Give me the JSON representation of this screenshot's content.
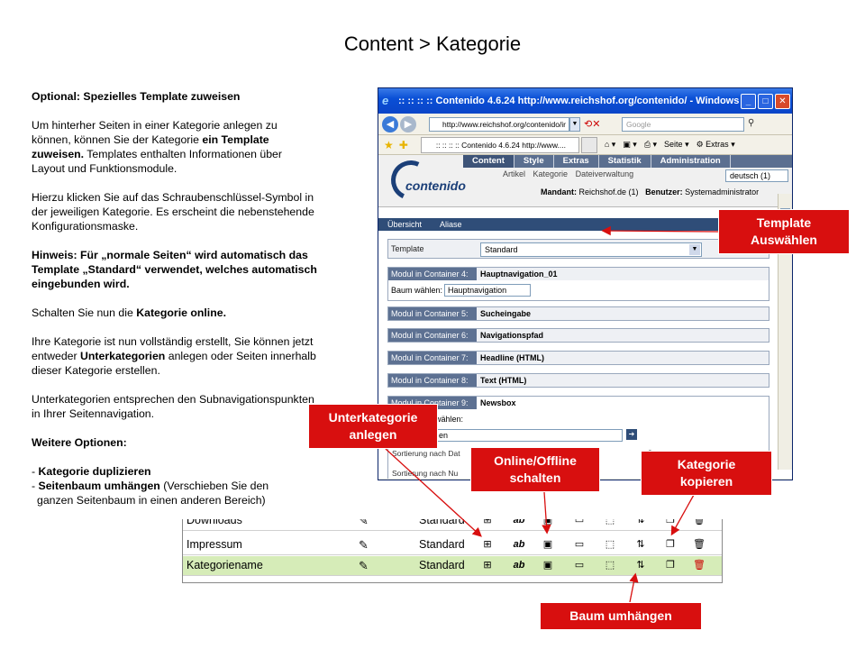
{
  "slide": {
    "title": "Content > Kategorie"
  },
  "instructions": {
    "heading": "Optional: Spezielles Template zuweisen",
    "p1_a": "Um hinterher Seiten in einer Kategorie anlegen zu können, können Sie der Kategorie ",
    "p1_b": "ein Template zuweisen.",
    "p1_c": " Templates enthalten Informationen über Layout und Funktionsmodule.",
    "p2": "Hierzu klicken Sie auf das Schraubenschlüssel-Symbol in der jeweiligen Kategorie. Es erscheint die nebenstehende Konfigurationsmaske.",
    "p3": "Hinweis: Für „normale Seiten“ wird automatisch das Template „Standard“ verwendet, welches automatisch eingebunden wird.",
    "p4_a": "Schalten Sie nun die ",
    "p4_b": "Kategorie online.",
    "p5_a": "Ihre Kategorie ist nun vollständig erstellt, Sie können jetzt entweder ",
    "p5_b": "Unterkategorien",
    "p5_c": " anlegen oder Seiten innerhalb dieser Kategorie erstellen.",
    "p6": "Unterkategorien entsprechen den Subnavigationspunkten in Ihrer Seitennavigation.",
    "p7": "Weitere Optionen:",
    "opt1_a": "- ",
    "opt1_b": "Kategorie duplizieren",
    "opt2_a": "- ",
    "opt2_b": "Seitenbaum umhängen",
    "opt2_c": " (Verschieben Sie den",
    "opt2_d": "ganzen Seitenbaum in einen anderen Bereich)"
  },
  "browser": {
    "title": ":: :: :: :: Contenido 4.6.24 http://www.reichshof.org/contenido/ - Windows Inter...",
    "address": "http://www.reichshof.org/contenido/ir",
    "search_placeholder": "Google",
    "tab_title": ":: :: :: :: Contenido 4.6.24 http://www....",
    "toolbar_page": "Seite",
    "toolbar_extras": "Extras"
  },
  "contenido": {
    "logo": "contenido",
    "mainnav": [
      "Content",
      "Style",
      "Extras",
      "Statistik",
      "Administration"
    ],
    "subnav": [
      "Artikel",
      "Kategorie",
      "Dateiverwaltung"
    ],
    "language": "deutsch (1)",
    "mandant_label": "Mandant:",
    "mandant_value": "Reichshof.de (1)",
    "user_label": "Benutzer:",
    "user_value": "Systemadministrator",
    "tabs": [
      "Übersicht",
      "Aliase"
    ],
    "template_label": "Template",
    "template_value": "Standard",
    "containers": [
      {
        "label": "Modul in Container 4:",
        "value": "Hauptnavigation_01"
      },
      {
        "label": "Modul in Container 5:",
        "value": "Sucheingabe"
      },
      {
        "label": "Modul in Container 6:",
        "value": "Navigationspfad"
      },
      {
        "label": "Modul in Container 7:",
        "value": "Headline (HTML)"
      },
      {
        "label": "Modul in Container 8:",
        "value": "Text (HTML)"
      },
      {
        "label": "Modul in Container 9:",
        "value": "Newsbox"
      }
    ],
    "baum_label": "Baum wählen:",
    "baum_value": "Hauptnavigation",
    "newsbox_label_fragment": "wählen:",
    "newsbox_select_fragment": "en",
    "sort1": "Sortierung nach Dat",
    "sort2": "Sortierung nach Nu"
  },
  "category_table": {
    "rows": [
      {
        "name": "Downloads",
        "template": "Standard"
      },
      {
        "name": "Impressum",
        "template": "Standard"
      },
      {
        "name": "Kategoriename",
        "template": "Standard"
      }
    ]
  },
  "callouts": {
    "template": [
      "Template",
      "Auswählen"
    ],
    "unterkategorie": [
      "Unterkategorie",
      "anlegen"
    ],
    "online": [
      "Online/Offline",
      "schalten"
    ],
    "kopieren": [
      "Kategorie",
      "kopieren"
    ],
    "baum": "Baum umhängen"
  },
  "colors": {
    "callout_red": "#d80f0f",
    "highlight_row": "#d6ecb8",
    "contenido_nav": "#5b6f90"
  }
}
